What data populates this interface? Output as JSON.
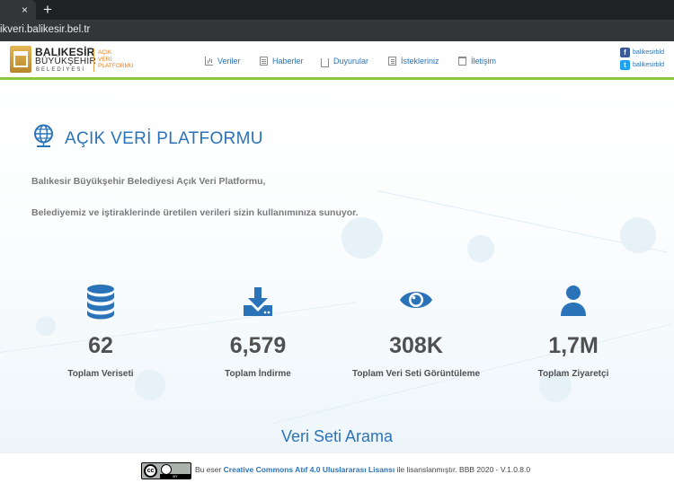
{
  "browser": {
    "tab_close": "×",
    "new_tab": "+",
    "url": "ikveri.balikesir.bel.tr"
  },
  "logo": {
    "title_line1": "BALIKESİR",
    "title_line2": "BÜYÜKŞEHİR",
    "title_line3": "BELEDİYESİ",
    "sub_line1": "AÇIK",
    "sub_line2": "VERİ",
    "sub_line3": "PLATFORMU"
  },
  "nav": {
    "items": [
      {
        "label": "Veriler",
        "icon": "chart-icon"
      },
      {
        "label": "Haberler",
        "icon": "edit-icon"
      },
      {
        "label": "Duyurular",
        "icon": "inbox-icon"
      },
      {
        "label": "İstekleriniz",
        "icon": "list-icon"
      },
      {
        "label": "İletişim",
        "icon": "trash-icon"
      }
    ]
  },
  "social": {
    "facebook": "balikesirbld",
    "twitter": "balikesirbld"
  },
  "hero": {
    "title": "AÇIK VERİ PLATFORMU",
    "desc1": "Balıkesir Büyükşehir Belediyesi Açık Veri Platformu,",
    "desc2": "Belediyemiz ve iştiraklerinde üretilen verileri sizin kullanımınıza sunuyor."
  },
  "stats": [
    {
      "value": "62",
      "label": "Toplam Veriseti",
      "icon": "database-icon"
    },
    {
      "value": "6,579",
      "label": "Toplam İndirme",
      "icon": "download-icon"
    },
    {
      "value": "308K",
      "label": "Toplam Veri Seti Görüntüleme",
      "icon": "eye-icon"
    },
    {
      "value": "1,7M",
      "label": "Toplam Ziyaretçi",
      "icon": "user-icon"
    }
  ],
  "search": {
    "title": "Veri Seti Arama"
  },
  "footer": {
    "cc_badge_text": "cc",
    "cc_bar": "BY",
    "prefix": "Bu eser",
    "license": "Creative Commons Atıf 4.0 Uluslararası Lisansı",
    "suffix": "ile lisanslanmıştır. BBB 2020 - V.1.0.8.0"
  },
  "colors": {
    "accent_blue": "#2b73b8",
    "green_bar": "#8cc63f",
    "logo_gold": "#c8962f",
    "logo_orange": "#e67e22"
  }
}
